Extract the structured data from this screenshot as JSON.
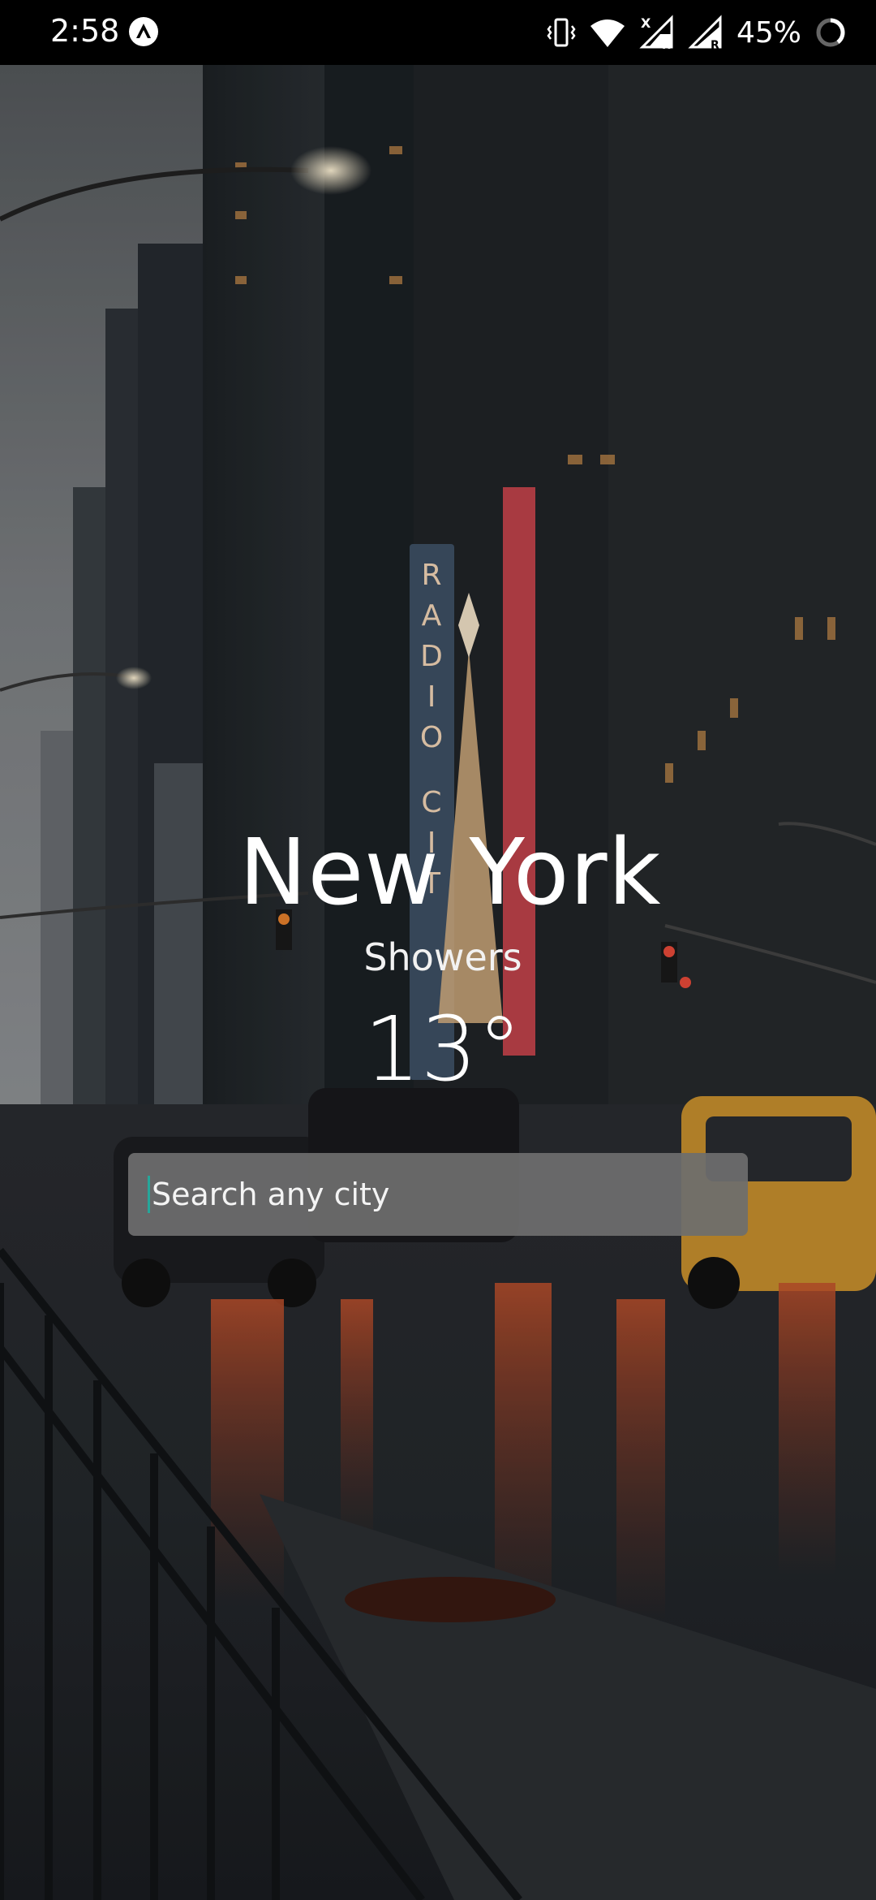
{
  "status_bar": {
    "time": "2:58",
    "battery_percent": "45%",
    "icons": [
      "expo-app-icon",
      "vibrate-icon",
      "wifi-icon",
      "signal-x-icon",
      "signal-r-icon",
      "battery-ring-icon"
    ]
  },
  "weather": {
    "city": "New York",
    "condition": "Showers",
    "temperature": "13°"
  },
  "search": {
    "placeholder": "Search any city"
  },
  "colors": {
    "search_background": "#6e6e6e",
    "cursor": "#26a69a",
    "text": "#ffffff"
  }
}
